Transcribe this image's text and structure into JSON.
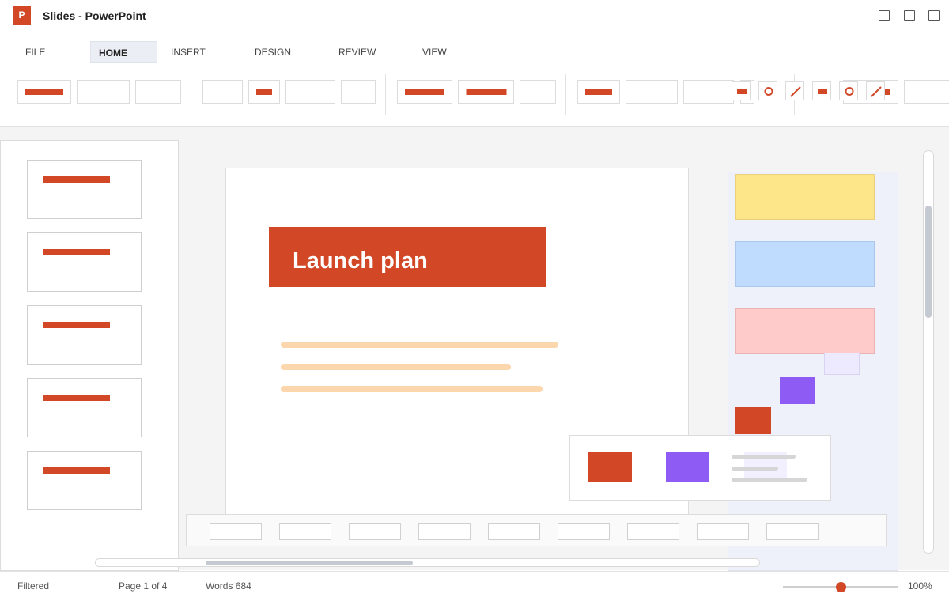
{
  "window": {
    "app_icon_letter": "P",
    "title": "Slides - PowerPoint"
  },
  "tabs": [
    {
      "label": "FILE",
      "active": false
    },
    {
      "label": "HOME",
      "active": true
    },
    {
      "label": "INSERT",
      "active": false
    },
    {
      "label": "DESIGN",
      "active": false
    },
    {
      "label": "REVIEW",
      "active": false
    },
    {
      "label": "VIEW",
      "active": false
    }
  ],
  "slide": {
    "title": "Launch plan"
  },
  "status": {
    "filter": "Filtered",
    "page": "Page 1 of 4",
    "words": "Words 684",
    "zoom": "100%",
    "zoom_level_fraction": 0.5
  },
  "colors": {
    "accent": "#d24726",
    "purple": "#8e5cf5",
    "sticky_yellow": "#fde68a",
    "sticky_blue": "#bfdbfe",
    "sticky_pink": "#fecaca",
    "lavender": "#ede9fe",
    "text_line": "#fcd6ad"
  },
  "icons": {
    "ribbon_shapes": [
      "rectangle-icon",
      "circle-icon",
      "line-icon"
    ]
  }
}
